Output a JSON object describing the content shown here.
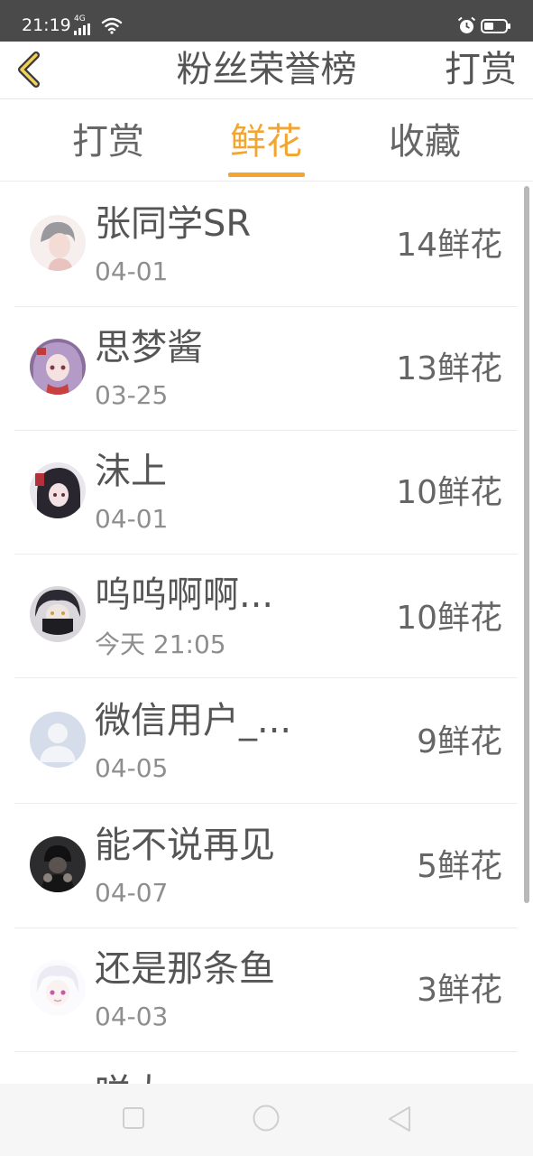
{
  "status_bar": {
    "time": "21:19",
    "network": "4G",
    "icons": [
      "signal-icon",
      "wifi-icon",
      "alarm-icon",
      "battery-icon"
    ]
  },
  "header": {
    "title": "粉丝荣誉榜",
    "action_label": "打赏",
    "back_icon": "chevron-left-icon"
  },
  "tabs": [
    {
      "label": "打赏",
      "active": false
    },
    {
      "label": "鲜花",
      "active": true
    },
    {
      "label": "收藏",
      "active": false
    }
  ],
  "colors": {
    "accent": "#f2a531",
    "status_bar_bg": "#4a4a4a",
    "text": "#555555",
    "secondary_text": "#8e8e8e"
  },
  "fans": [
    {
      "name": "张同学SR",
      "date": "04-01",
      "count": "14鲜花"
    },
    {
      "name": "思梦酱",
      "date": "03-25",
      "count": "13鲜花"
    },
    {
      "name": "沫上",
      "date": "04-01",
      "count": "10鲜花"
    },
    {
      "name": "呜呜啊啊...",
      "date": "今天 21:05",
      "count": "10鲜花"
    },
    {
      "name": "微信用户_...",
      "date": "04-05",
      "count": "9鲜花"
    },
    {
      "name": "能不说再见",
      "date": "04-07",
      "count": "5鲜花"
    },
    {
      "name": "还是那条鱼",
      "date": "04-03",
      "count": "3鲜花"
    },
    {
      "name": "咩大",
      "date": "",
      "count": ""
    }
  ],
  "nav_bar": {
    "icons": [
      "recents-square-icon",
      "home-circle-icon",
      "back-triangle-icon"
    ]
  }
}
